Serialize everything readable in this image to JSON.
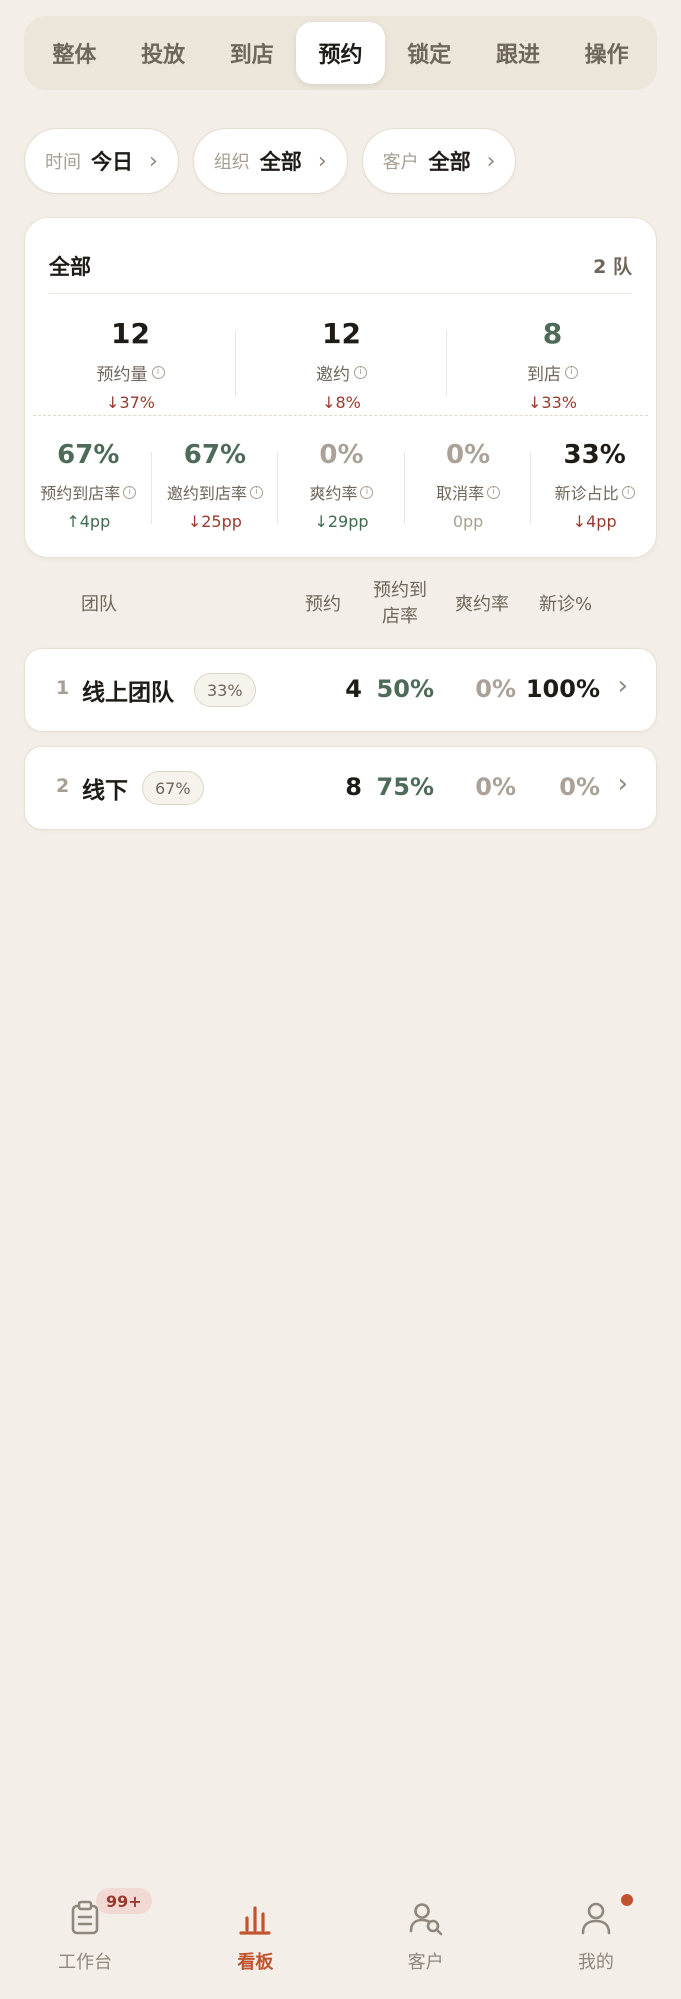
{
  "tabs": [
    "整体",
    "投放",
    "到店",
    "预约",
    "锁定",
    "跟进",
    "操作"
  ],
  "active_tab_index": 3,
  "filters": [
    {
      "label": "时间",
      "value": "今日"
    },
    {
      "label": "组织",
      "value": "全部"
    },
    {
      "label": "客户",
      "value": "全部"
    }
  ],
  "summary": {
    "title": "全部",
    "count": "2 队",
    "top_stats": [
      {
        "value": "12",
        "name": "预约量",
        "delta": "↓37%"
      },
      {
        "value": "12",
        "name": "邀约",
        "delta": "↓8%"
      },
      {
        "value": "8",
        "name": "到店",
        "delta": "↓33%"
      }
    ],
    "rate_stats": [
      {
        "value": "67%",
        "name": "预约到店率",
        "delta": "↑4pp"
      },
      {
        "value": "67%",
        "name": "邀约到店率",
        "delta": "↓25pp"
      },
      {
        "value": "0%",
        "name": "爽约率",
        "delta": "↓29pp"
      },
      {
        "value": "0%",
        "name": "取消率",
        "delta": "0pp"
      },
      {
        "value": "33%",
        "name": "新诊占比",
        "delta": "↓4pp"
      }
    ]
  },
  "table": {
    "headers": {
      "team": "团队",
      "booking": "预约",
      "arrival_rate_l1": "预约到",
      "arrival_rate_l2": "店率",
      "noshow": "爽约率",
      "new": "新诊%"
    },
    "rows": [
      {
        "index": "1",
        "name": "线上团队",
        "badge": "33%",
        "booking": "4",
        "arrival_rate": "50%",
        "noshow": "0%",
        "new": "100%"
      },
      {
        "index": "2",
        "name": "线下",
        "badge": "67%",
        "booking": "8",
        "arrival_rate": "75%",
        "noshow": "0%",
        "new": "0%"
      }
    ]
  },
  "nav": [
    {
      "label": "工作台",
      "icon": "clipboard-icon",
      "badge": "99+"
    },
    {
      "label": "看板",
      "icon": "bar-chart-icon"
    },
    {
      "label": "客户",
      "icon": "user-search-icon"
    },
    {
      "label": "我的",
      "icon": "user-icon"
    }
  ],
  "colors": {
    "background": "#f3efe8",
    "accent": "#c0542e",
    "positive_green": "#4d6b58",
    "negative_red": "#9a3a2e"
  }
}
